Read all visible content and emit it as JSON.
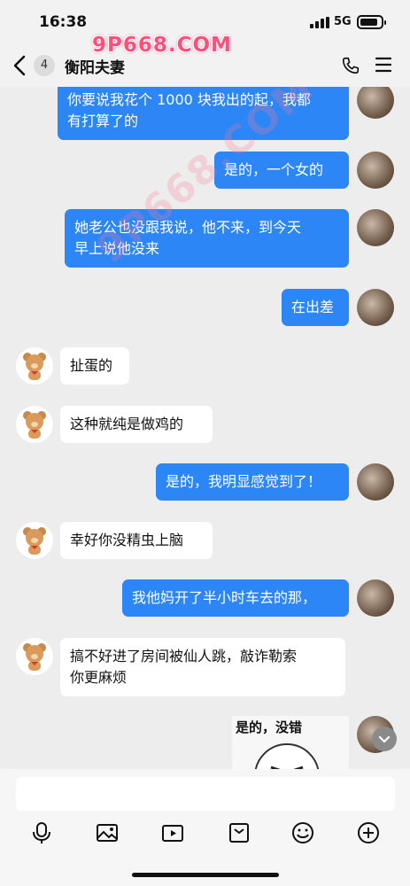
{
  "status": {
    "time": "16:38",
    "network": "5G"
  },
  "header": {
    "back_count": "4",
    "title": "衡阳夫妻",
    "watermark": "9P668.COM"
  },
  "messages": [
    {
      "from": "self",
      "text": "你要说我花个 1000 块我出的起，我都\n有打算了的"
    },
    {
      "from": "self",
      "text": "是的，一个女的"
    },
    {
      "from": "self",
      "text": "她老公也没跟我说，他不来，到今天\n早上说他没来"
    },
    {
      "from": "self",
      "text": "在出差"
    },
    {
      "from": "peer",
      "text": "扯蛋的"
    },
    {
      "from": "peer",
      "text": "这种就纯是做鸡的"
    },
    {
      "from": "self",
      "text": "是的，我明显感觉到了！"
    },
    {
      "from": "peer",
      "text": "幸好你没精虫上脑"
    },
    {
      "from": "self",
      "text": "我他妈开了半小时车去的那，"
    },
    {
      "from": "peer",
      "text": "搞不好进了房间被仙人跳，敲诈勒索\n你更麻烦"
    },
    {
      "from": "self",
      "sticker_text": "是的，没错"
    }
  ],
  "input": {
    "placeholder": "",
    "value": ""
  },
  "toolbar": [
    "mic-icon",
    "image-icon",
    "video-icon",
    "file-icon",
    "emoji-icon",
    "plus-icon"
  ],
  "colors": {
    "outgoing_bubble": "#2c86f5",
    "incoming_bubble": "#ffffff",
    "background": "#ededed"
  }
}
